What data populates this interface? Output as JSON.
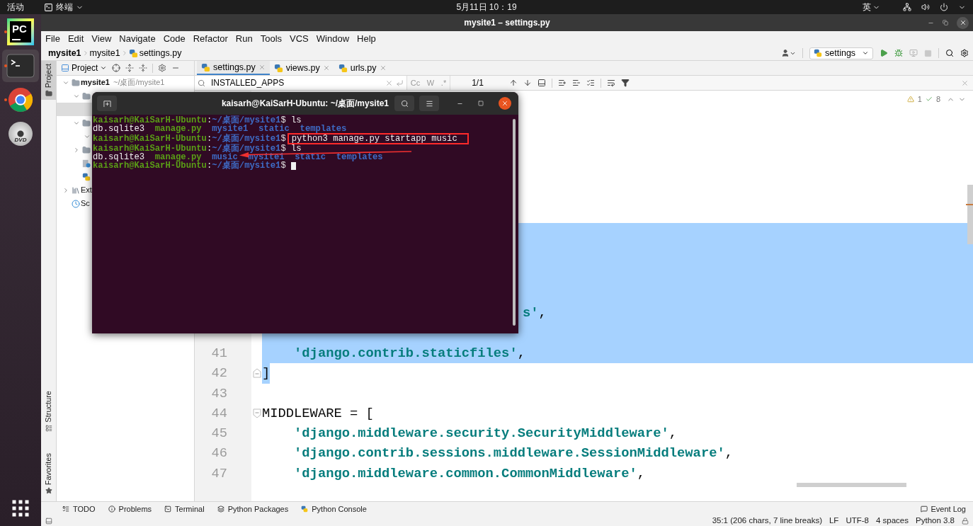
{
  "top_bar": {
    "activities": "活动",
    "app_menu": "终端",
    "clock": "5月11日 10：19",
    "input_method": "英"
  },
  "dock": [
    {
      "kind": "pycharm",
      "logo_text": "PC",
      "running": true,
      "selected": false
    },
    {
      "kind": "terminal",
      "running": true,
      "selected": true
    },
    {
      "kind": "browser",
      "running": true,
      "selected": false
    },
    {
      "kind": "disc",
      "logo_text": "DVD",
      "running": false,
      "selected": false
    }
  ],
  "ide": {
    "title": "mysite1 – settings.py",
    "menu": [
      "File",
      "Edit",
      "View",
      "Navigate",
      "Code",
      "Refactor",
      "Run",
      "Tools",
      "VCS",
      "Window",
      "Help"
    ],
    "breadcrumb": [
      {
        "label": "mysite1",
        "bold": true
      },
      {
        "label": "mysite1",
        "bold": false
      },
      {
        "label": "settings.py",
        "bold": false
      }
    ],
    "run_config": "settings",
    "side_tabs": [
      {
        "label": "Project",
        "kind": "project",
        "selected": true
      },
      {
        "label": "Structure",
        "kind": "structure",
        "selected": false
      },
      {
        "label": "Favorites",
        "kind": "favorites",
        "selected": false
      }
    ],
    "project_panel": {
      "title": "Project",
      "tree": [
        {
          "label": "mysite1",
          "hint": "~/桌面/mysite1",
          "kind": "folder",
          "expanded": true,
          "selected": false,
          "children": [
            {
              "kind": "folder",
              "expanded": true,
              "selected": false,
              "children": [
                {
                  "selected": true
                }
              ]
            },
            {
              "kind": "folder",
              "expanded": true,
              "selected": false,
              "children": [
                {
                  "expanded": true
                }
              ]
            },
            {
              "kind": "folder",
              "expanded": false,
              "selected": false
            },
            {
              "kind": "text_file",
              "selected": false
            },
            {
              "kind": "python_file",
              "selected": false
            }
          ]
        },
        {
          "label": "Ext",
          "kind": "libraries",
          "expanded": false,
          "selected": false
        },
        {
          "label": "Sc",
          "kind": "scratches",
          "selected": false
        }
      ]
    },
    "tabs": [
      {
        "label": "settings.py",
        "selected": true
      },
      {
        "label": "views.py",
        "selected": false
      },
      {
        "label": "urls.py",
        "selected": false
      }
    ],
    "search": {
      "value": "INSTALLED_APPS",
      "options": [
        "Cc",
        "W",
        ".*"
      ],
      "match_count": "1/1"
    },
    "inspections": {
      "warnings": "1",
      "checks": "8"
    },
    "code_lines": [
      {
        "selected": true,
        "partial": false
      },
      {
        "selected": true,
        "partial": false
      },
      {
        "selected": true,
        "partial": false
      },
      {
        "selected": true,
        "partial": false
      },
      {
        "selected": true,
        "partial": false,
        "kind": "fragment",
        "segments": [
          {
            "text": "s'",
            "kind": "string"
          },
          {
            "text": ",",
            "kind": "plain"
          }
        ]
      },
      {
        "selected": true,
        "partial": false
      },
      {
        "number": "41",
        "selected": true,
        "partial": false,
        "indented": true,
        "segments": [
          {
            "text": "'django.contrib.staticfiles'",
            "kind": "string"
          },
          {
            "text": ",",
            "kind": "plain"
          }
        ]
      },
      {
        "number": "42",
        "selected": true,
        "partial": true,
        "fold": {
          "kind": "end"
        },
        "segments": [
          {
            "text": "]",
            "kind": "plain"
          }
        ]
      },
      {
        "number": "43",
        "selected": false
      },
      {
        "number": "44",
        "selected": false,
        "fold": {
          "kind": "start"
        },
        "segments": [
          {
            "text": "MIDDLEWARE = [",
            "kind": "plain"
          }
        ]
      },
      {
        "number": "45",
        "selected": false,
        "indented": true,
        "segments": [
          {
            "text": "'django.middleware.security.SecurityMiddleware'",
            "kind": "string"
          },
          {
            "text": ",",
            "kind": "plain"
          }
        ]
      },
      {
        "number": "46",
        "selected": false,
        "indented": true,
        "segments": [
          {
            "text": "'django.contrib.sessions.middleware.SessionMiddleware'",
            "kind": "string"
          },
          {
            "text": ",",
            "kind": "plain"
          }
        ]
      },
      {
        "number": "47",
        "selected": false,
        "indented": true,
        "segments": [
          {
            "text": "'django.middleware.common.CommonMiddleware'",
            "kind": "string"
          },
          {
            "text": ",",
            "kind": "plain"
          }
        ]
      }
    ],
    "tool_windows": [
      {
        "label": "TODO",
        "kind": "todo"
      },
      {
        "label": "Problems",
        "kind": "problems"
      },
      {
        "label": "Terminal",
        "kind": "terminal"
      },
      {
        "label": "Python Packages",
        "kind": "packages"
      },
      {
        "label": "Python Console",
        "kind": "console"
      }
    ],
    "event_log": "Event Log",
    "status": [
      "35:1 (206 chars, 7 line breaks)",
      "LF",
      "UTF-8",
      "4 spaces",
      "Python 3.8"
    ]
  },
  "terminal": {
    "title": "kaisarh@KaiSarH-Ubuntu: ~/桌面/mysite1",
    "lines": [
      {
        "kind": "prompt",
        "user": "kaisarh@KaiSarH-Ubuntu",
        "separator": ":",
        "path": "~/桌面/mysite1",
        "symbol": "$",
        "command": "ls",
        "highlighted": false
      },
      {
        "kind": "output",
        "entries": [
          {
            "name": "db.sqlite3",
            "kind": "file"
          },
          {
            "name": "manage.py",
            "kind": "executable"
          },
          {
            "name": "mysite1",
            "kind": "directory"
          },
          {
            "name": "static",
            "kind": "directory"
          },
          {
            "name": "templates",
            "kind": "directory"
          }
        ]
      },
      {
        "kind": "prompt",
        "user": "kaisarh@KaiSarH-Ubuntu",
        "separator": ":",
        "path": "~/桌面/mysite1",
        "symbol": "$",
        "command": "python3 manage.py startapp music",
        "highlighted": true
      },
      {
        "kind": "prompt",
        "user": "kaisarh@KaiSarH-Ubuntu",
        "separator": ":",
        "path": "~/桌面/mysite1",
        "symbol": "$",
        "command": "ls",
        "highlighted": false
      },
      {
        "kind": "output",
        "entries": [
          {
            "name": "db.sqlite3",
            "kind": "file"
          },
          {
            "name": "manage.py",
            "kind": "executable"
          },
          {
            "name": "music",
            "kind": "directory"
          },
          {
            "name": "mysite1",
            "kind": "directory"
          },
          {
            "name": "static",
            "kind": "directory"
          },
          {
            "name": "templates",
            "kind": "directory"
          }
        ]
      },
      {
        "kind": "prompt",
        "user": "kaisarh@KaiSarH-Ubuntu",
        "separator": ":",
        "path": "~/桌面/mysite1",
        "symbol": "$",
        "cursor": true
      }
    ]
  }
}
